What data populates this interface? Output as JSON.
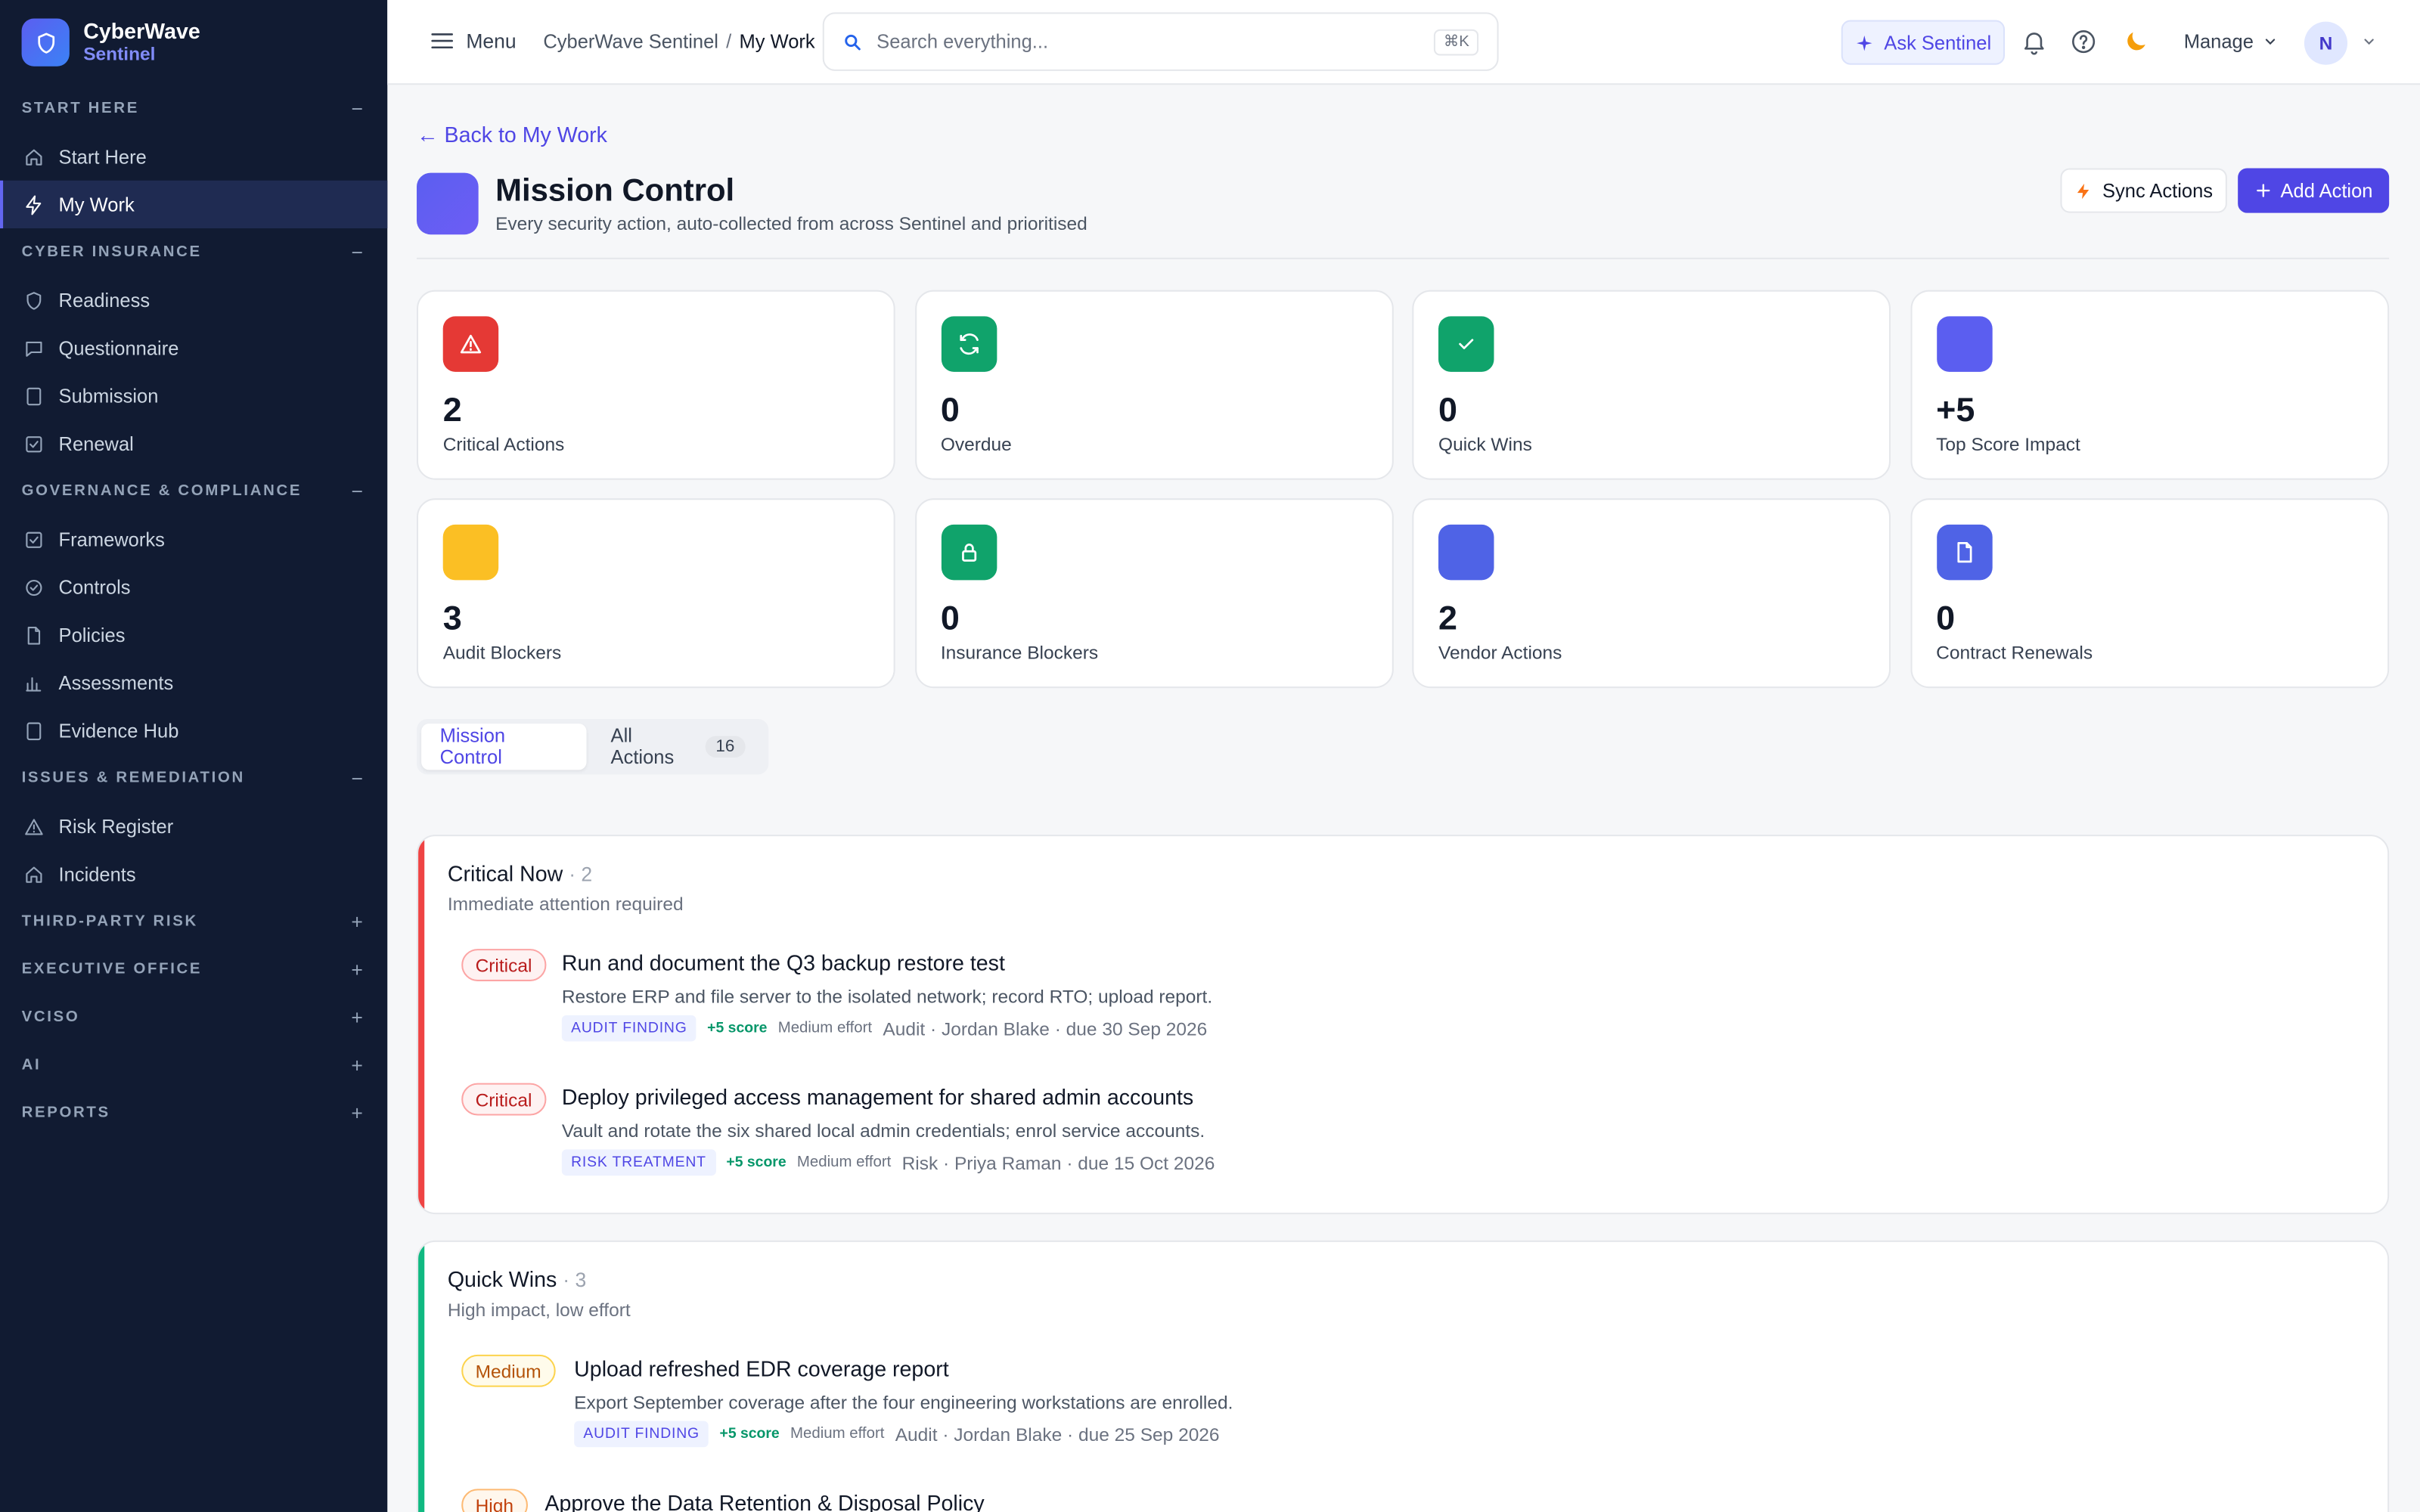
{
  "brand": {
    "name": "CyberWave",
    "product": "Sentinel"
  },
  "sidebar": {
    "sections": [
      {
        "label": "START HERE",
        "toggle": "−",
        "items": [
          {
            "label": "Start Here",
            "icon": "home-icon"
          },
          {
            "label": "My Work",
            "icon": "lightning-icon",
            "active": true
          }
        ]
      },
      {
        "label": "CYBER INSURANCE",
        "toggle": "−",
        "items": [
          {
            "label": "Readiness",
            "icon": "shield-icon"
          },
          {
            "label": "Questionnaire",
            "icon": "chat-icon"
          },
          {
            "label": "Submission",
            "icon": "file-icon"
          },
          {
            "label": "Renewal",
            "icon": "check-square-icon"
          }
        ]
      },
      {
        "label": "GOVERNANCE & COMPLIANCE",
        "toggle": "−",
        "items": [
          {
            "label": "Frameworks",
            "icon": "check-square-icon"
          },
          {
            "label": "Controls",
            "icon": "check-circle-icon"
          },
          {
            "label": "Policies",
            "icon": "document-icon"
          },
          {
            "label": "Assessments",
            "icon": "bar-chart-icon"
          },
          {
            "label": "Evidence Hub",
            "icon": "file-icon"
          }
        ]
      },
      {
        "label": "ISSUES & REMEDIATION",
        "toggle": "−",
        "items": [
          {
            "label": "Risk Register",
            "icon": "warning-icon"
          },
          {
            "label": "Incidents",
            "icon": "home-icon"
          }
        ]
      },
      {
        "label": "THIRD-PARTY RISK",
        "toggle": "+",
        "items": []
      },
      {
        "label": "EXECUTIVE OFFICE",
        "toggle": "+",
        "items": []
      },
      {
        "label": "VCISO",
        "toggle": "+",
        "items": []
      },
      {
        "label": "AI",
        "toggle": "+",
        "items": []
      },
      {
        "label": "REPORTS",
        "toggle": "+",
        "items": []
      }
    ]
  },
  "header": {
    "menu_label": "Menu",
    "breadcrumb": {
      "root": "CyberWave Sentinel",
      "sep": "/",
      "current": "My Work"
    },
    "search": {
      "placeholder": "Search everything...",
      "shortcut": "⌘K"
    },
    "ask_label": "Ask Sentinel",
    "manage_label": "Manage",
    "avatar_initial": "N"
  },
  "page": {
    "back_link": "← Back to My Work",
    "title": "Mission Control",
    "subtitle": "Every security action, auto-collected from across Sentinel and prioritised",
    "sync_label": "Sync Actions",
    "add_label": "Add Action"
  },
  "kpis": [
    {
      "value": "2",
      "label": "Critical Actions",
      "icon": "warning-icon",
      "color": "#e53935"
    },
    {
      "value": "0",
      "label": "Overdue",
      "icon": "refresh-icon",
      "color": "#10a36b"
    },
    {
      "value": "0",
      "label": "Quick Wins",
      "icon": "check-icon",
      "color": "#10a36b"
    },
    {
      "value": "+5",
      "label": "Top Score Impact",
      "icon": "",
      "color": "#5b5ef0"
    },
    {
      "value": "3",
      "label": "Audit Blockers",
      "icon": "",
      "color": "#fbbf24"
    },
    {
      "value": "0",
      "label": "Insurance Blockers",
      "icon": "lock-icon",
      "color": "#10a36b"
    },
    {
      "value": "2",
      "label": "Vendor Actions",
      "icon": "",
      "color": "#4f63e6"
    },
    {
      "value": "0",
      "label": "Contract Renewals",
      "icon": "document-icon",
      "color": "#4f63e6"
    }
  ],
  "tabs": [
    {
      "label": "Mission Control",
      "active": true
    },
    {
      "label": "All Actions",
      "count": "16"
    }
  ],
  "groups": [
    {
      "title": "Critical Now",
      "count": "· 2",
      "subtitle": "Immediate attention required",
      "accent": "#ef4444",
      "items": [
        {
          "priority": "Critical",
          "title": "Run and document the Q3 backup restore test",
          "desc": "Restore ERP and file server to the isolated network; record RTO; upload report.",
          "tag": "AUDIT FINDING",
          "score": "+5 score",
          "effort": "Medium effort",
          "owner": "Audit · Jordan Blake · due 30 Sep 2026"
        },
        {
          "priority": "Critical",
          "title": "Deploy privileged access management for shared admin accounts",
          "desc": "Vault and rotate the six shared local admin credentials; enrol service accounts.",
          "tag": "RISK TREATMENT",
          "score": "+5 score",
          "effort": "Medium effort",
          "owner": "Risk · Priya Raman · due 15 Oct 2026"
        }
      ]
    },
    {
      "title": "Quick Wins",
      "count": "· 3",
      "subtitle": "High impact, low effort",
      "accent": "#10b981",
      "items": [
        {
          "priority": "Medium",
          "title": "Upload refreshed EDR coverage report",
          "desc": "Export September coverage after the four engineering workstations are enrolled.",
          "tag": "AUDIT FINDING",
          "score": "+5 score",
          "effort": "Medium effort",
          "owner": "Audit · Jordan Blake · due 25 Sep 2026"
        },
        {
          "priority": "High",
          "title": "Approve the Data Retention & Disposal Policy",
          "desc": "",
          "tag": "",
          "score": "",
          "effort": "",
          "owner": ""
        }
      ]
    }
  ]
}
